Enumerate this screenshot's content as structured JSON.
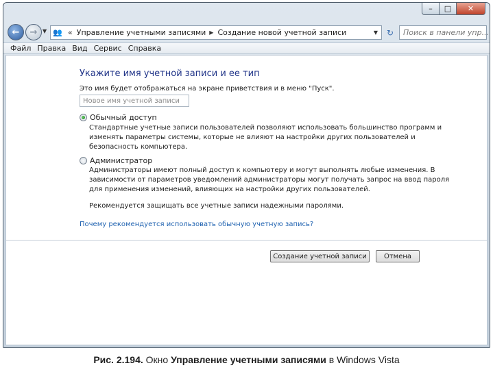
{
  "window": {
    "caption_buttons": {
      "minimize": "–",
      "maximize": "□",
      "close": "✕"
    }
  },
  "navbar": {
    "breadcrumb_prefix": "«",
    "breadcrumb_1": "Управление учетными записями",
    "breadcrumb_sep": "▶",
    "breadcrumb_2": "Создание новой учетной записи",
    "search_placeholder": "Поиск в панели упр..."
  },
  "menu": {
    "items": [
      "Файл",
      "Правка",
      "Вид",
      "Сервис",
      "Справка"
    ]
  },
  "form": {
    "heading": "Укажите имя учетной записи и ее тип",
    "hint": "Это имя будет отображаться на экране приветствия и в меню \"Пуск\".",
    "name_placeholder": "Новое имя учетной записи",
    "standard": {
      "label": "Обычный доступ",
      "checked": true,
      "desc_lines": [
        "Стандартные учетные записи пользователей позволяют использовать большинство программ и",
        "изменять параметры системы, которые не влияют на настройки других пользователей и",
        "безопасность компьютера."
      ]
    },
    "admin": {
      "label": "Администратор",
      "checked": false,
      "desc_lines": [
        "Администраторы имеют полный доступ к компьютеру и могут выполнять любые изменения. В",
        "зависимости от параметров уведомлений администраторы могут получать запрос на ввод пароля",
        "для применения изменений, влияющих на настройки других пользователей."
      ]
    },
    "recommendation": "Рекомендуется защищать все учетные записи надежными паролями.",
    "why_link": "Почему рекомендуется использовать обычную учетную запись?",
    "create_button": "Создание учетной записи",
    "cancel_button": "Отмена"
  },
  "caption": {
    "prefix": "Рис. 2.194.",
    "text_before": " Окно ",
    "bold": "Управление учетными записями",
    "text_after": " в Windows Vista"
  }
}
